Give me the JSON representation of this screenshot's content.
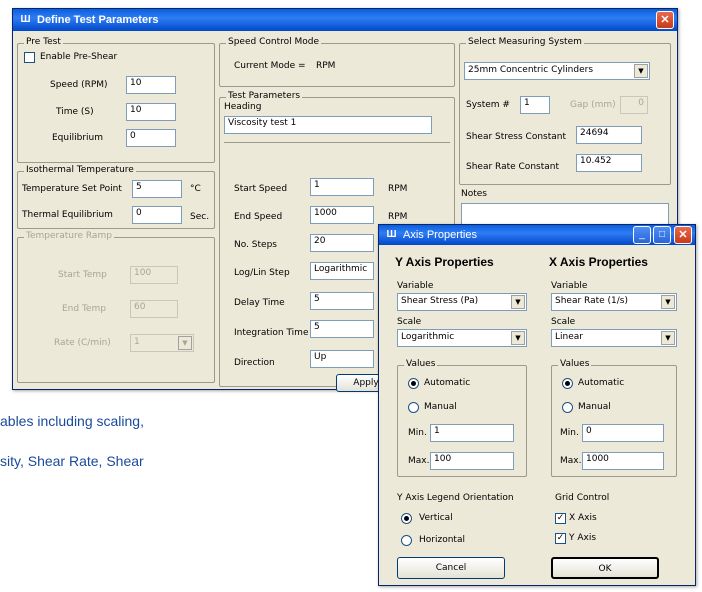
{
  "background": {
    "line1": "ables including scaling,",
    "line2": "sity, Shear Rate, Shear"
  },
  "main": {
    "title": "Define Test Parameters",
    "pre_test": {
      "legend": "Pre Test",
      "enable_label": "Enable Pre-Shear",
      "speed_label": "Speed (RPM)",
      "speed": "10",
      "time_label": "Time (S)",
      "time": "10",
      "equilibrium_label": "Equilibrium",
      "equilibrium": "0"
    },
    "iso": {
      "legend": "Isothermal Temperature",
      "setpoint_label": "Temperature Set Point",
      "setpoint": "5",
      "setpoint_unit": "°C",
      "equil_label": "Thermal Equilibrium",
      "equil": "0",
      "equil_unit": "Sec."
    },
    "ramp": {
      "legend": "Temperature Ramp",
      "start_label": "Start Temp",
      "start": "100",
      "end_label": "End Temp",
      "end": "60",
      "rate_label": "Rate (C/min)",
      "rate": "1"
    },
    "speed_mode": {
      "legend": "Speed Control Mode",
      "current_label": "Current Mode =",
      "current_value": "RPM"
    },
    "test_params": {
      "legend": "Test Parameters",
      "heading_label": "Heading",
      "heading": "Viscosity test 1",
      "start_speed_label": "Start Speed",
      "start_speed": "1",
      "start_speed_unit": "RPM",
      "end_speed_label": "End Speed",
      "end_speed": "1000",
      "end_speed_unit": "RPM",
      "steps_label": "No. Steps",
      "steps": "20",
      "loglin_label": "Log/Lin Step",
      "loglin": "Logarithmic",
      "delay_label": "Delay Time",
      "delay": "5",
      "integration_label": "Integration Time",
      "integration": "5",
      "direction_label": "Direction",
      "direction": "Up",
      "apply_label": "Apply"
    },
    "measuring": {
      "legend": "Select Measuring System",
      "system": "25mm Concentric Cylinders",
      "system_no_label": "System #",
      "system_no": "1",
      "gap_label": "Gap (mm)",
      "gap": "0",
      "stress_label": "Shear Stress Constant",
      "stress": "24694",
      "rate_label": "Shear Rate Constant",
      "rate": "10.452"
    },
    "notes_label": "Notes"
  },
  "axis": {
    "title": "Axis Properties",
    "y": {
      "header": "Y Axis Properties",
      "variable_label": "Variable",
      "variable": "Shear Stress (Pa)",
      "scale_label": "Scale",
      "scale": "Logarithmic",
      "values_legend": "Values",
      "automatic": "Automatic",
      "manual": "Manual",
      "min_label": "Min.",
      "min": "1",
      "max_label": "Max.",
      "max": "100",
      "legend_orient_label": "Y Axis Legend Orientation",
      "vertical": "Vertical",
      "horizontal": "Horizontal"
    },
    "x": {
      "header": "X Axis Properties",
      "variable_label": "Variable",
      "variable": "Shear Rate (1/s)",
      "scale_label": "Scale",
      "scale": "Linear",
      "values_legend": "Values",
      "automatic": "Automatic",
      "manual": "Manual",
      "min_label": "Min.",
      "min": "0",
      "max_label": "Max.",
      "max": "1000",
      "grid_label": "Grid Control",
      "x_axis": "X Axis",
      "y_axis": "Y Axis"
    },
    "cancel_label": "Cancel",
    "ok_label": "OK"
  },
  "icons": {
    "check": "✓",
    "dropdown": "▼",
    "app": "Ш",
    "close": "✕",
    "minimize": "_",
    "maximize": "□"
  }
}
